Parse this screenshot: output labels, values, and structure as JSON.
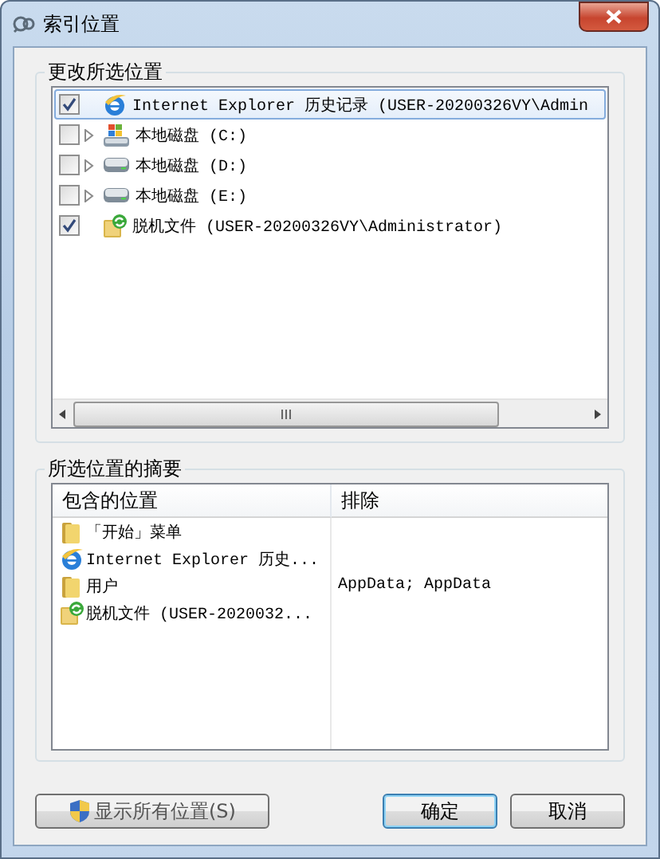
{
  "window": {
    "title": "索引位置"
  },
  "change_locations": {
    "title": "更改所选位置",
    "items": [
      {
        "kind": "ie",
        "label": "Internet Explorer 历史记录 (USER-20200326VY\\Admin",
        "checked": true,
        "expandable": false,
        "selected": true
      },
      {
        "kind": "windows-drive",
        "label": "本地磁盘 (C:)",
        "checked": false,
        "expandable": true,
        "selected": false
      },
      {
        "kind": "drive",
        "label": "本地磁盘 (D:)",
        "checked": false,
        "expandable": true,
        "selected": false
      },
      {
        "kind": "drive",
        "label": "本地磁盘 (E:)",
        "checked": false,
        "expandable": true,
        "selected": false
      },
      {
        "kind": "offline",
        "label": "脱机文件 (USER-20200326VY\\Administrator)",
        "checked": true,
        "expandable": false,
        "selected": false
      }
    ]
  },
  "summary": {
    "title": "所选位置的摘要",
    "columns": [
      "包含的位置",
      "排除"
    ],
    "rows": [
      {
        "kind": "folder",
        "location": "「开始」菜单"
      },
      {
        "kind": "ie",
        "location": "Internet Explorer 历史..."
      },
      {
        "kind": "folder",
        "location": "用户",
        "exclude": "AppData; AppData"
      },
      {
        "kind": "offline",
        "location": "脱机文件 (USER-2020032..."
      }
    ]
  },
  "buttons": [
    {
      "kind": "shield",
      "label": "显示所有位置(S)"
    },
    {
      "kind": "default",
      "label": "确定"
    },
    {
      "kind": "plain",
      "label": "取消"
    }
  ]
}
